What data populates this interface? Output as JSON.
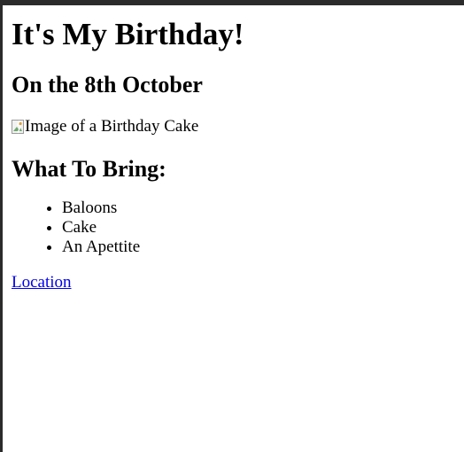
{
  "page": {
    "heading": "It's My Birthday!",
    "subheading": "On the 8th October",
    "image": {
      "alt_text": "Image of a Birthday Cake",
      "icon": "broken-image-icon"
    },
    "section_heading": "What To Bring:",
    "items": [
      {
        "label": "Baloons"
      },
      {
        "label": "Cake"
      },
      {
        "label": "An Apettite"
      }
    ],
    "link_label": "Location"
  },
  "colors": {
    "link": "#0000ee",
    "text": "#000000",
    "frame": "#2b2b2b"
  }
}
